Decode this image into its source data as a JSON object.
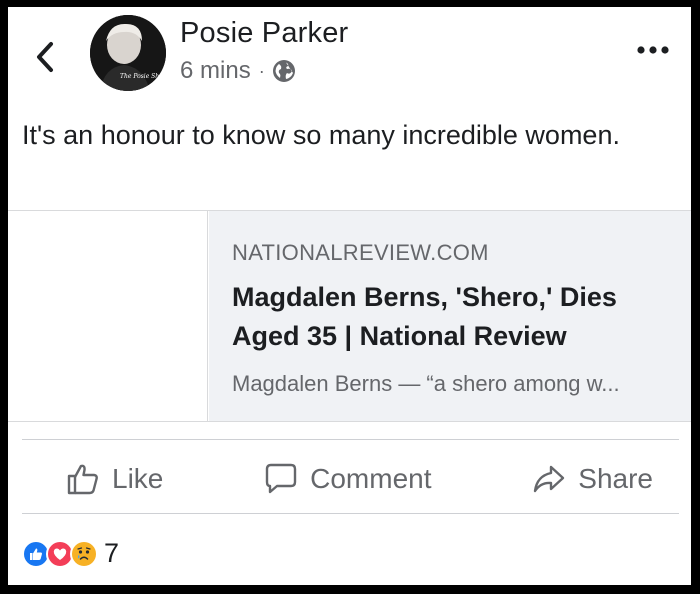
{
  "post": {
    "author": "Posie Parker",
    "time": "6 mins",
    "separator": "·",
    "privacy_icon": "globe-icon",
    "avatar_caption": "The Posie Show",
    "text": "It's an honour to know so many incredible women."
  },
  "link": {
    "domain": "NATIONALREVIEW.COM",
    "title": "Magdalen Berns, 'Shero,' Dies Aged 35 | National Review",
    "description": "Magdalen Berns — “a shero among w..."
  },
  "actions": {
    "like": "Like",
    "comment": "Comment",
    "share": "Share"
  },
  "reactions": {
    "icons": [
      "like-reaction-icon",
      "love-reaction-icon",
      "sad-reaction-icon"
    ],
    "count": "7"
  },
  "colors": {
    "text": "#1c1e21",
    "secondary": "#65676b",
    "like_blue": "#1877f2",
    "love_red": "#f33e58",
    "sad_yellow": "#f7b125",
    "card_bg": "#f0f2f5"
  }
}
